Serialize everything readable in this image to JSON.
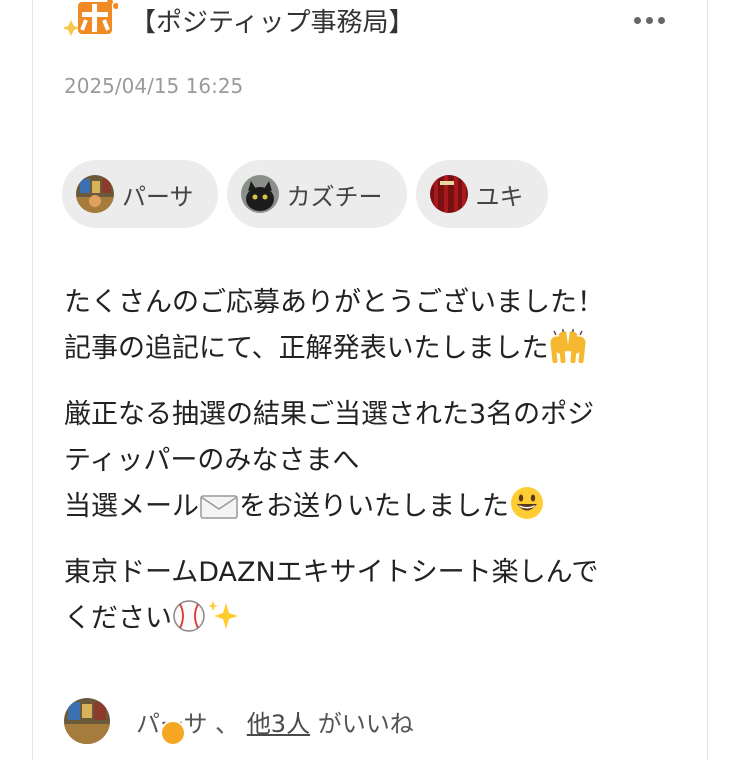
{
  "post": {
    "author": "【ポジティップ事務局】",
    "timestamp": "2025/04/15 16:25",
    "mentions": [
      {
        "name": "パーサ",
        "avatar": "avatar-photo-icon"
      },
      {
        "name": "カズチー",
        "avatar": "cat-avatar-icon"
      },
      {
        "name": "ユキ",
        "avatar": "curtain-avatar-icon"
      }
    ],
    "paragraphs": [
      "たくさんのご応募ありがとうございました！\n記事の追記にて、正解発表いたしました",
      "厳正なる抽選の結果ご当選された3名のポジ\nティッパーのみなさまへ\n当選メール",
      "をお送りいたしました",
      "東京ドームDAZNエキサイトシート楽しんで\nください"
    ],
    "likes": {
      "first_name": "パーサ",
      "separator": "、",
      "others": "他3人",
      "suffix": "がいいね"
    }
  },
  "colors": {
    "chip_bg": "#ececec",
    "timestamp": "#9a9a9a",
    "logo_orange": "#f08a24"
  },
  "icons": [
    "logo-icon",
    "more-icon",
    "raised-hands-emoji",
    "envelope-emoji",
    "smile-emoji",
    "baseball-emoji",
    "sparkles-emoji"
  ]
}
